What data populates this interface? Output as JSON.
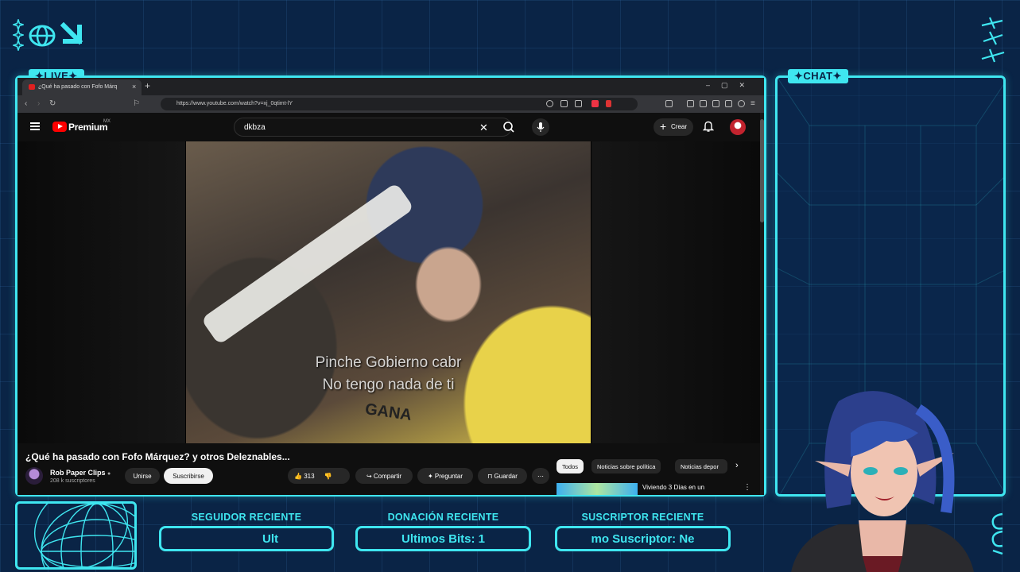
{
  "overlay": {
    "live_tag": "✦LIVE✦",
    "chat_tag": "✦CHAT✦",
    "accent_color": "#3fe6f0",
    "background_color": "#0a2446",
    "stats": [
      {
        "label": "SEGUIDOR RECIENTE",
        "value": "Ult"
      },
      {
        "label": "DONACIÓN RECIENTE",
        "value": "Ultimos Bits: 1"
      },
      {
        "label": "SUSCRIPTOR RECIENTE",
        "value": "mo Suscriptor: Ne"
      }
    ]
  },
  "browser": {
    "tab_title": "¿Qué ha pasado con Fofo Márq",
    "url": "https://www.youtube.com/watch?v=xj_0qtimt-lY"
  },
  "youtube": {
    "brand": "Premium",
    "region": "MX",
    "search_value": "dkbza",
    "create_label": "Crear",
    "video": {
      "subtitle_line1": "Pinche Gobierno cabr",
      "subtitle_line2": "No tengo nada de ti",
      "shirt_text": "GANA"
    },
    "title": "¿Qué ha pasado con Fofo Márquez? y otros Deleznables...",
    "channel": {
      "name": "Rob Paper Clips",
      "subscribers": "208 k suscriptores"
    },
    "buttons": {
      "join": "Unirse",
      "subscribe": "Suscribirse",
      "likes": "313",
      "share": "Compartir",
      "ask": "Preguntar",
      "save": "Guardar"
    },
    "chips": [
      "Todos",
      "Noticias sobre política",
      "Noticias depor"
    ],
    "recommended_title": "Viviendo 3 Días en un"
  }
}
